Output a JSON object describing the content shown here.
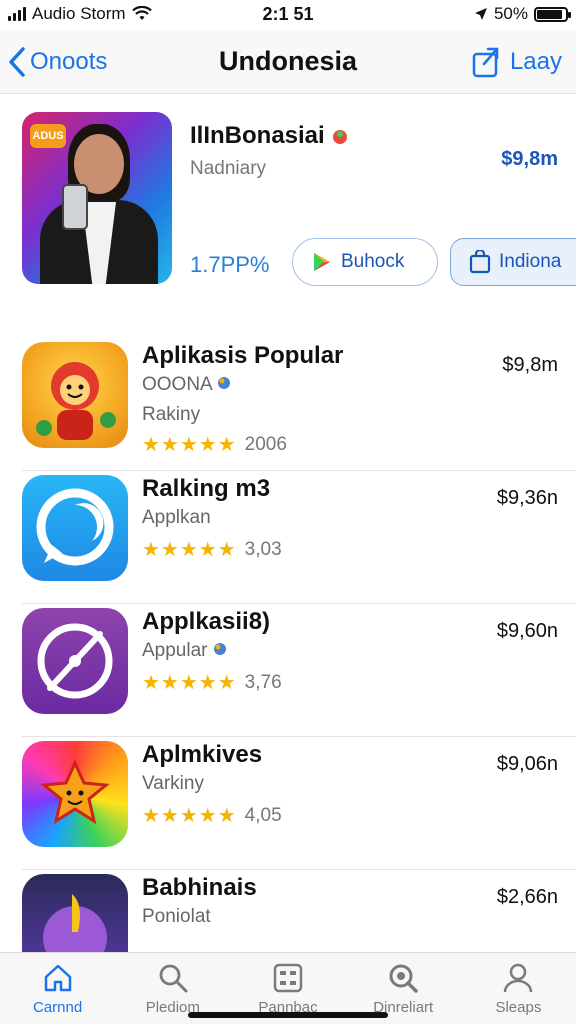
{
  "status_bar": {
    "carrier": "Audio Storm",
    "time": "2:1 51",
    "battery": "50%",
    "battery_level": 0.9
  },
  "nav": {
    "back_label": "Onoots",
    "title": "Undonesia",
    "right_label": "Laay"
  },
  "featured": {
    "badge": "ADUS",
    "name": "IlInBonasiai",
    "subtitle": "Nadniary",
    "price": "$9,8m",
    "stat": "1.7PP%",
    "get_button": "Buhock",
    "install_button": "Indiona"
  },
  "apps": [
    {
      "name": "Aplikasis Popular",
      "subtitle": "OOONA",
      "category": "Rakiny",
      "rating": 4.5,
      "rating_count": "2006",
      "price": "$9,8m",
      "icon": "mascot-icon",
      "color": "#f5a623"
    },
    {
      "name": "Ralking m3",
      "subtitle": "Applkan",
      "category": "",
      "rating": 4.5,
      "rating_count": "3,03",
      "price": "$9,36n",
      "icon": "chat-bubble-icon",
      "color": "#1e88e5"
    },
    {
      "name": "Applkasii8)",
      "subtitle": "Appular",
      "category": "",
      "rating": 4.5,
      "rating_count": "3,76",
      "price": "$9,60n",
      "icon": "compass-icon",
      "color": "#8e44ad"
    },
    {
      "name": "Aplmkives",
      "subtitle": "Varkiny",
      "category": "",
      "rating": 4.5,
      "rating_count": "4,05",
      "price": "$9,06n",
      "icon": "star-face-icon",
      "color": "#ff9f1a"
    },
    {
      "name": "Babhinais",
      "subtitle": "Poniolat",
      "category": "",
      "rating": 0,
      "rating_count": "",
      "price": "$2,66n",
      "icon": "feather-icon",
      "color": "#5b3aa8"
    }
  ],
  "tabs": [
    {
      "label": "Carnnd",
      "icon": "home-icon",
      "active": true
    },
    {
      "label": "Plediom",
      "icon": "search-icon",
      "active": false
    },
    {
      "label": "Pannbac",
      "icon": "grid-icon",
      "active": false
    },
    {
      "label": "Dinreliart",
      "icon": "magnify-icon",
      "active": false
    },
    {
      "label": "Sleaps",
      "icon": "person-icon",
      "active": false
    }
  ]
}
